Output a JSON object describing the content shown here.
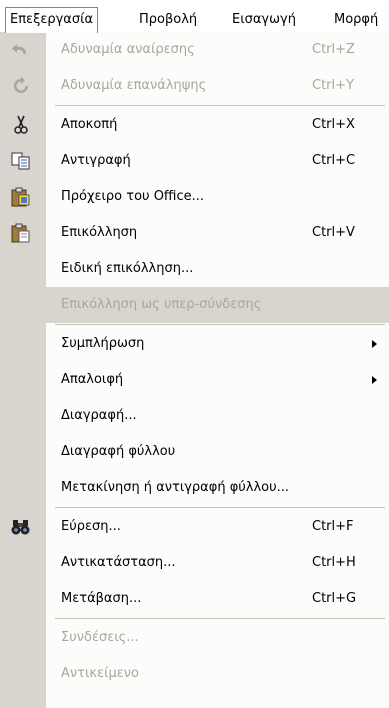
{
  "menubar": {
    "items": [
      {
        "label": "Επεξεργασία"
      },
      {
        "label": "Προβολή"
      },
      {
        "label": "Εισαγωγή"
      },
      {
        "label": "Μορφή"
      }
    ]
  },
  "menu": {
    "items": [
      {
        "label": "Αδυναμία αναίρεσης",
        "shortcut": "Ctrl+Z"
      },
      {
        "label": "Αδυναμία επανάληψης",
        "shortcut": "Ctrl+Y"
      },
      {
        "label": "Αποκοπή",
        "shortcut": "Ctrl+X"
      },
      {
        "label": "Αντιγραφή",
        "shortcut": "Ctrl+C"
      },
      {
        "label": "Πρόχειρο του Office..."
      },
      {
        "label": "Επικόλληση",
        "shortcut": "Ctrl+V"
      },
      {
        "label": "Ειδική επικόλληση..."
      },
      {
        "label": "Επικόλληση ως υπερ-σύνδεσης"
      },
      {
        "label": "Συμπλήρωση"
      },
      {
        "label": "Απαλοιφή"
      },
      {
        "label": "Διαγραφή..."
      },
      {
        "label": "Διαγραφή φύλλου"
      },
      {
        "label": "Μετακίνηση ή αντιγραφή φύλλου..."
      },
      {
        "label": "Εύρεση...",
        "shortcut": "Ctrl+F"
      },
      {
        "label": "Αντικατάσταση...",
        "shortcut": "Ctrl+H"
      },
      {
        "label": "Μετάβαση...",
        "shortcut": "Ctrl+G"
      },
      {
        "label": "Συνδέσεις..."
      },
      {
        "label": "Αντικείμενο"
      }
    ]
  },
  "icons": {
    "undo": "undo-icon",
    "redo": "redo-icon",
    "cut": "scissors-icon",
    "copy": "copy-icon",
    "clipboard": "office-clipboard-icon",
    "paste": "paste-icon",
    "find": "binoculars-icon"
  },
  "colors": {
    "icon_strip": "#d8d5cf",
    "menu_bg": "#fcfcfb",
    "disabled_text": "#a8a6a0"
  }
}
